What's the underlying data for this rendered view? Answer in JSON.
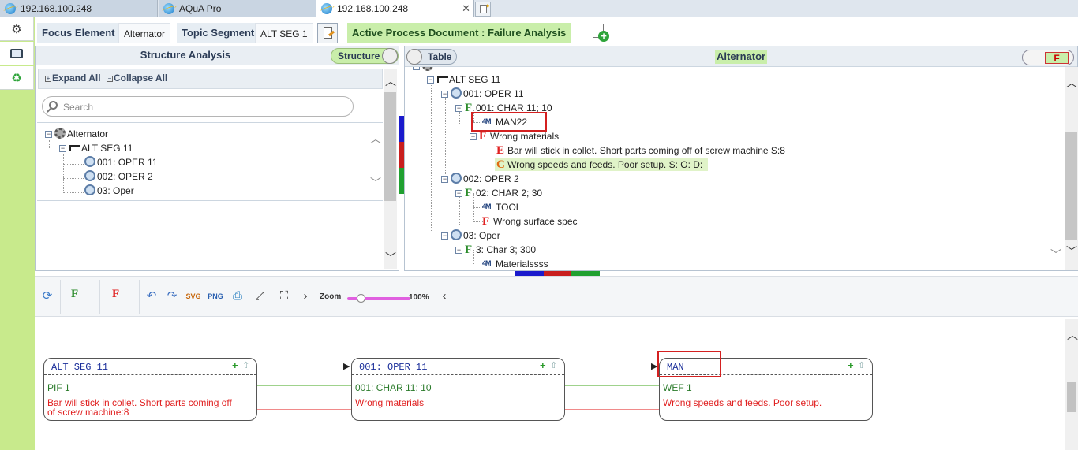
{
  "browser": {
    "tabs": [
      {
        "title": "192.168.100.248"
      },
      {
        "title": "AQuA Pro"
      },
      {
        "title": "192.168.100.248",
        "close": "✕"
      }
    ]
  },
  "rail": {
    "icons": [
      "gear-icon",
      "screen-icon",
      "recycle-icon"
    ]
  },
  "header": {
    "focus_label": "Focus Element :",
    "focus_value": "Alternator",
    "topic_label": "Topic Segment",
    "topic_value": "ALT SEG 1",
    "active_doc": "Active Process Document : Failure Analysis"
  },
  "structure": {
    "title": "Structure Analysis",
    "toggle_label": "Structure",
    "expand_all": "Expand All",
    "collapse_all": "Collapse All",
    "search_placeholder": "Search",
    "tree": [
      {
        "label": "Alternator"
      },
      {
        "label": "ALT SEG 11"
      },
      {
        "label": "001: OPER 11"
      },
      {
        "label": "002: OPER 2"
      },
      {
        "label": "03: Oper"
      }
    ]
  },
  "analysis": {
    "toggle_label": "Table",
    "title": "Alternator",
    "f_toggle": "F",
    "tree": [
      {
        "label": "ALT SEG 11"
      },
      {
        "label": "001: OPER 11"
      },
      {
        "marker": "F",
        "label": "001: CHAR 11; 10"
      },
      {
        "label": "MAN22"
      },
      {
        "marker": "F",
        "label": "Wrong materials"
      },
      {
        "marker": "E",
        "label": "Bar will stick in collet. Short parts coming off of screw machine S:8"
      },
      {
        "marker": "C",
        "label": "Wrong speeds and feeds. Poor setup. S: O: D:"
      },
      {
        "label": "002: OPER 2"
      },
      {
        "marker": "F",
        "label": "02: CHAR 2; 30"
      },
      {
        "label": "TOOL"
      },
      {
        "marker": "F",
        "label": "Wrong surface spec"
      },
      {
        "label": "03: Oper"
      },
      {
        "marker": "F",
        "label": "3: Char 3; 300"
      },
      {
        "label": "Materialssss"
      }
    ]
  },
  "toolbar": {
    "f_green": "F",
    "f_red": "F",
    "zoom_label": "Zoom",
    "zoom_value": "100%",
    "zoom_fraction": 0.15
  },
  "diagram": {
    "nodes": [
      {
        "title": "ALT SEG 11",
        "line1": "PIF 1",
        "line2": "Bar will stick in collet. Short parts coming off of screw machine:8"
      },
      {
        "title": "001:  OPER 11",
        "line1": "001:  CHAR 11;  10",
        "line2": "Wrong materials"
      },
      {
        "title": "MAN",
        "line1": "WEF 1",
        "line2": "Wrong speeds and feeds. Poor setup."
      }
    ]
  },
  "colors": {
    "accent_green": "#c9eeaa",
    "rail_green": "#c8ea8c",
    "failure_red": "#e02020",
    "function_green": "#2a8b2a",
    "highlight_box": "#d42020"
  }
}
